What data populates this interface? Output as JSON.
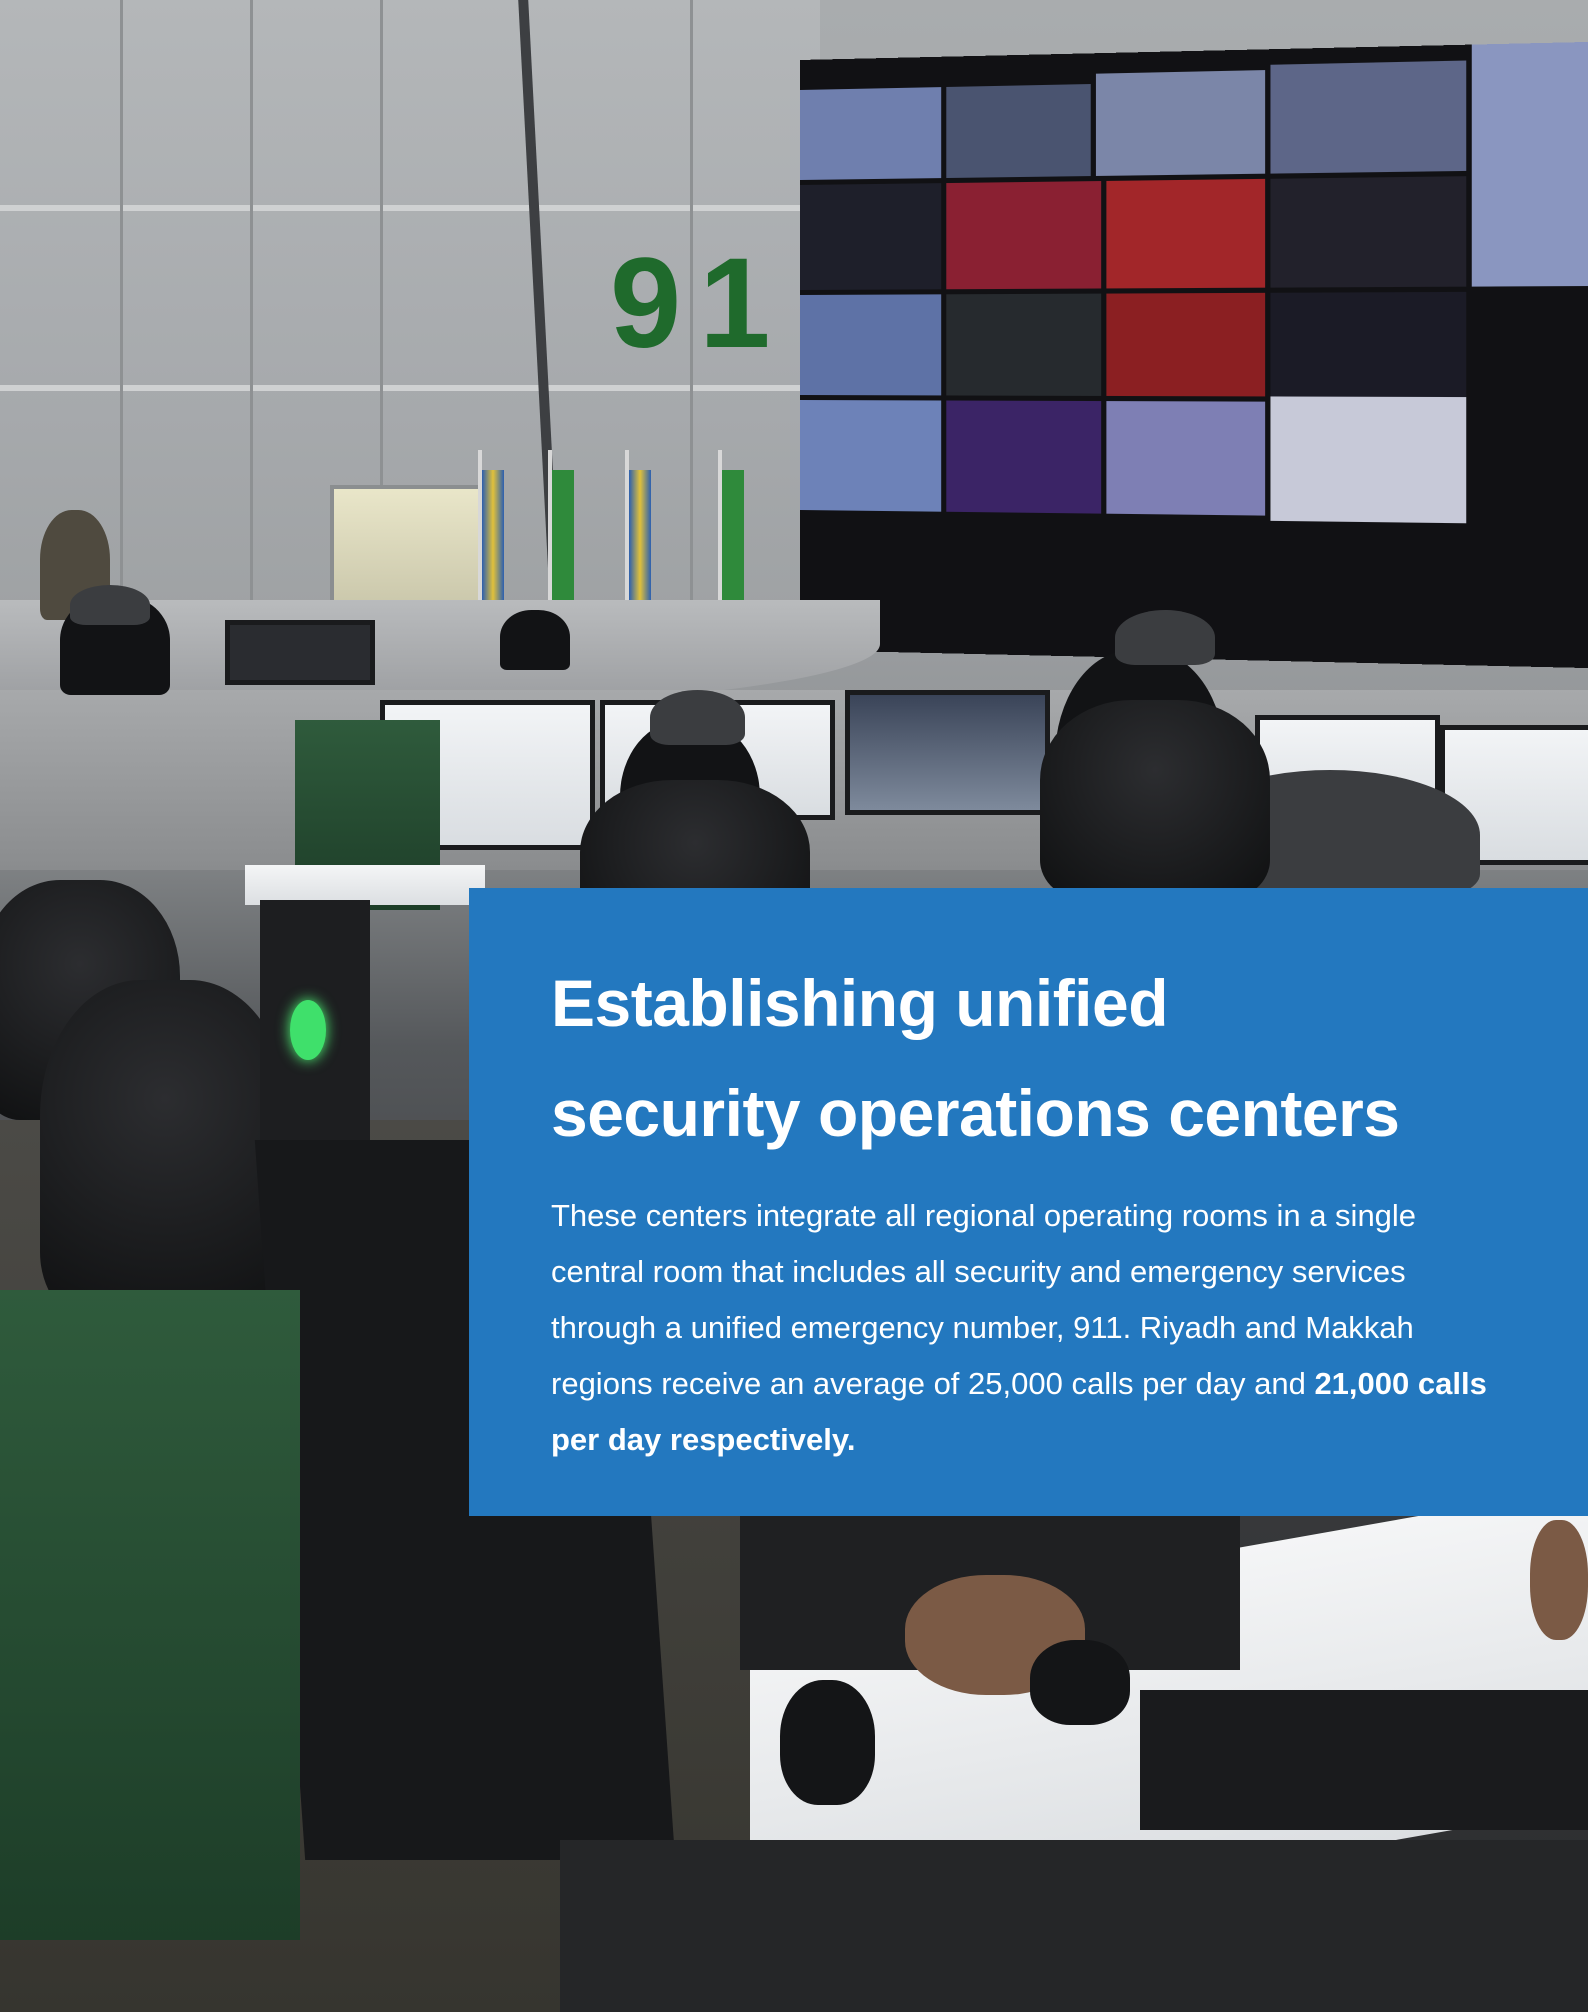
{
  "wall_sign": "91",
  "heading": {
    "line1": "Establishing unified",
    "line2": "security operations centers"
  },
  "body": {
    "text": "These centers integrate all regional operating rooms in a single central room that includes all security and emergency services through a unified emergency number, 911. Riyadh and Makkah regions receive an average of 25,000 calls per day and ",
    "bold_text": "21,000 calls per day respectively."
  },
  "colors": {
    "panel": "#2378bf",
    "text": "#ffffff",
    "sign": "#1f6a2c"
  }
}
